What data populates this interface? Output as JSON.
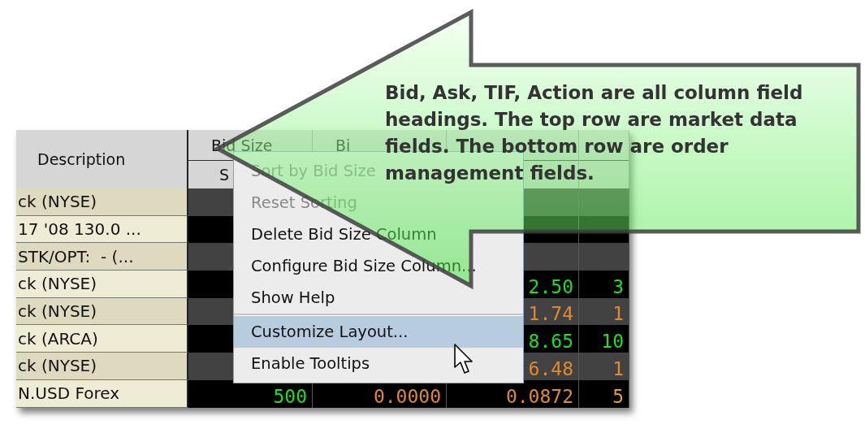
{
  "table": {
    "columns": [
      {
        "top": "Description"
      },
      {
        "top": "Bid Size",
        "bottom": "S"
      },
      {
        "top": "Bi"
      }
    ],
    "rows": [
      {
        "description": "ck (NYSE)",
        "cells": []
      },
      {
        "description": "17 '08 130.0 ...",
        "cells": []
      },
      {
        "description": "STK/OPT:  - (...",
        "cells": []
      },
      {
        "description": "ck (NYSE)",
        "cells": [
          null,
          null,
          {
            "text": "2.50",
            "color": "#22dd22"
          },
          {
            "text": "3",
            "color": "#22dd22"
          }
        ]
      },
      {
        "description": "ck (NYSE)",
        "cells": [
          null,
          null,
          {
            "text": "1.74",
            "color": "#e08a30"
          },
          {
            "text": "1",
            "color": "#e08a30"
          }
        ]
      },
      {
        "description": "ck (ARCA)",
        "cells": [
          null,
          null,
          {
            "text": "8.65",
            "color": "#22dd22"
          },
          {
            "text": "10",
            "color": "#22dd22"
          }
        ]
      },
      {
        "description": "ck (NYSE)",
        "cells": [
          null,
          null,
          {
            "text": "6.48",
            "color": "#e08a30"
          },
          {
            "text": "1",
            "color": "#e08a30"
          }
        ]
      },
      {
        "description": "N.USD Forex",
        "cells": [
          {
            "text": "500",
            "color": "#22dd22"
          },
          {
            "text": "0.0000",
            "color": "#e08a30"
          },
          {
            "text": "0.0872",
            "color": "#e08a30"
          },
          {
            "text": "5",
            "color": "#e0a020"
          }
        ]
      }
    ]
  },
  "context_menu": {
    "items": [
      {
        "label": "Sort by Bid Size",
        "disabled": true,
        "selected": false
      },
      {
        "label": "Reset Sorting",
        "disabled": true,
        "selected": false
      },
      {
        "label": "Delete Bid Size Column",
        "disabled": false,
        "selected": false
      },
      {
        "label": "Configure Bid Size Column...",
        "disabled": false,
        "selected": false
      },
      {
        "label": "Show Help",
        "disabled": false,
        "selected": false,
        "separator_after": true
      },
      {
        "label": "Customize Layout...",
        "disabled": false,
        "selected": true
      },
      {
        "label": "Enable Tooltips",
        "disabled": false,
        "selected": false
      }
    ]
  },
  "callout": {
    "text": "Bid, Ask, TIF, Action are all column field headings. The top row are market data fields. The bottom row are order management fields."
  }
}
